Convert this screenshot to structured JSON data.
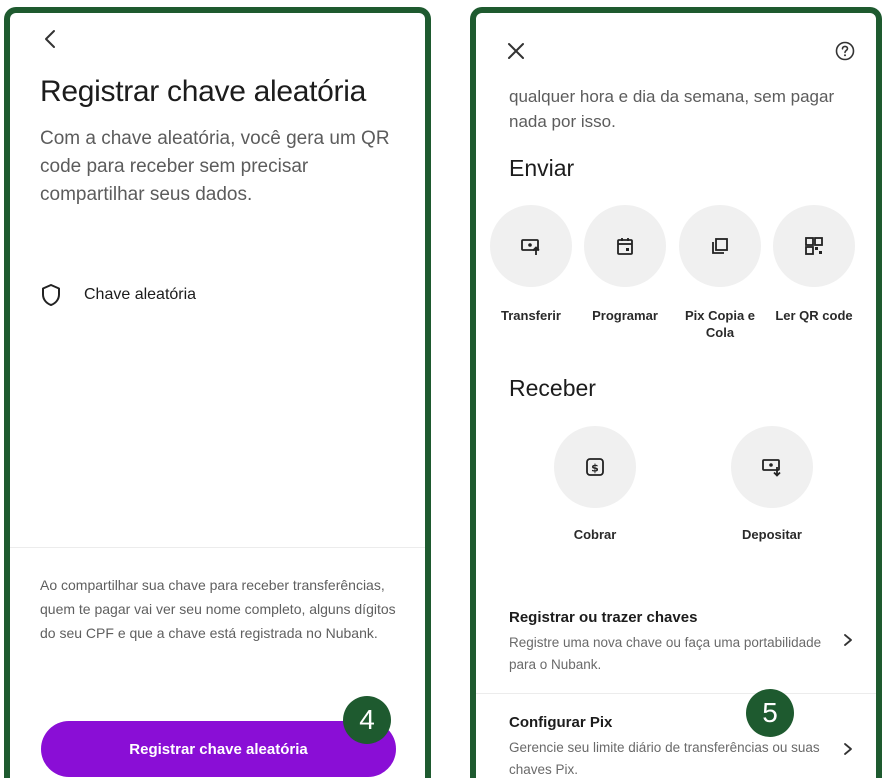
{
  "left_screen": {
    "title": "Registrar chave aleatória",
    "description": "Com a chave aleatória, você gera um QR code para receber sem precisar compartilhar seus dados.",
    "key_type_label": "Chave aleatória",
    "disclaimer": "Ao compartilhar sua chave para receber transferências, quem te pagar vai ver seu nome completo, alguns dígitos do seu CPF  e que a chave está registrada no Nubank.",
    "button_label": "Registrar chave aleatória",
    "step_number": "4",
    "icons": [
      "chevron-left-icon",
      "shield-icon"
    ]
  },
  "right_screen": {
    "intro_text": "qualquer hora e dia da semana, sem pagar nada por isso.",
    "send_section_title": "Enviar",
    "send_actions": [
      {
        "label": "Transferir",
        "icon": "transfer-icon"
      },
      {
        "label": "Programar",
        "icon": "calendar-icon"
      },
      {
        "label": "Pix Copia e Cola",
        "icon": "copy-icon"
      },
      {
        "label": "Ler QR code",
        "icon": "qr-code-icon"
      }
    ],
    "receive_section_title": "Receber",
    "receive_actions": [
      {
        "label": "Cobrar",
        "icon": "charge-icon"
      },
      {
        "label": "Depositar",
        "icon": "deposit-icon"
      }
    ],
    "rows": [
      {
        "title": "Registrar ou trazer chaves",
        "subtitle": "Registre uma nova chave ou faça uma portabilidade para o Nubank."
      },
      {
        "title": "Configurar Pix",
        "subtitle": "Gerencie seu limite diário de transferências ou suas chaves Pix."
      }
    ],
    "step_number": "5",
    "icons": [
      "close-icon",
      "help-icon",
      "chevron-right-icon"
    ]
  },
  "colors": {
    "frame_green": "#1e5a2f",
    "nubank_purple": "#8a0ed6",
    "action_circle_bg": "#f0f0f0"
  }
}
